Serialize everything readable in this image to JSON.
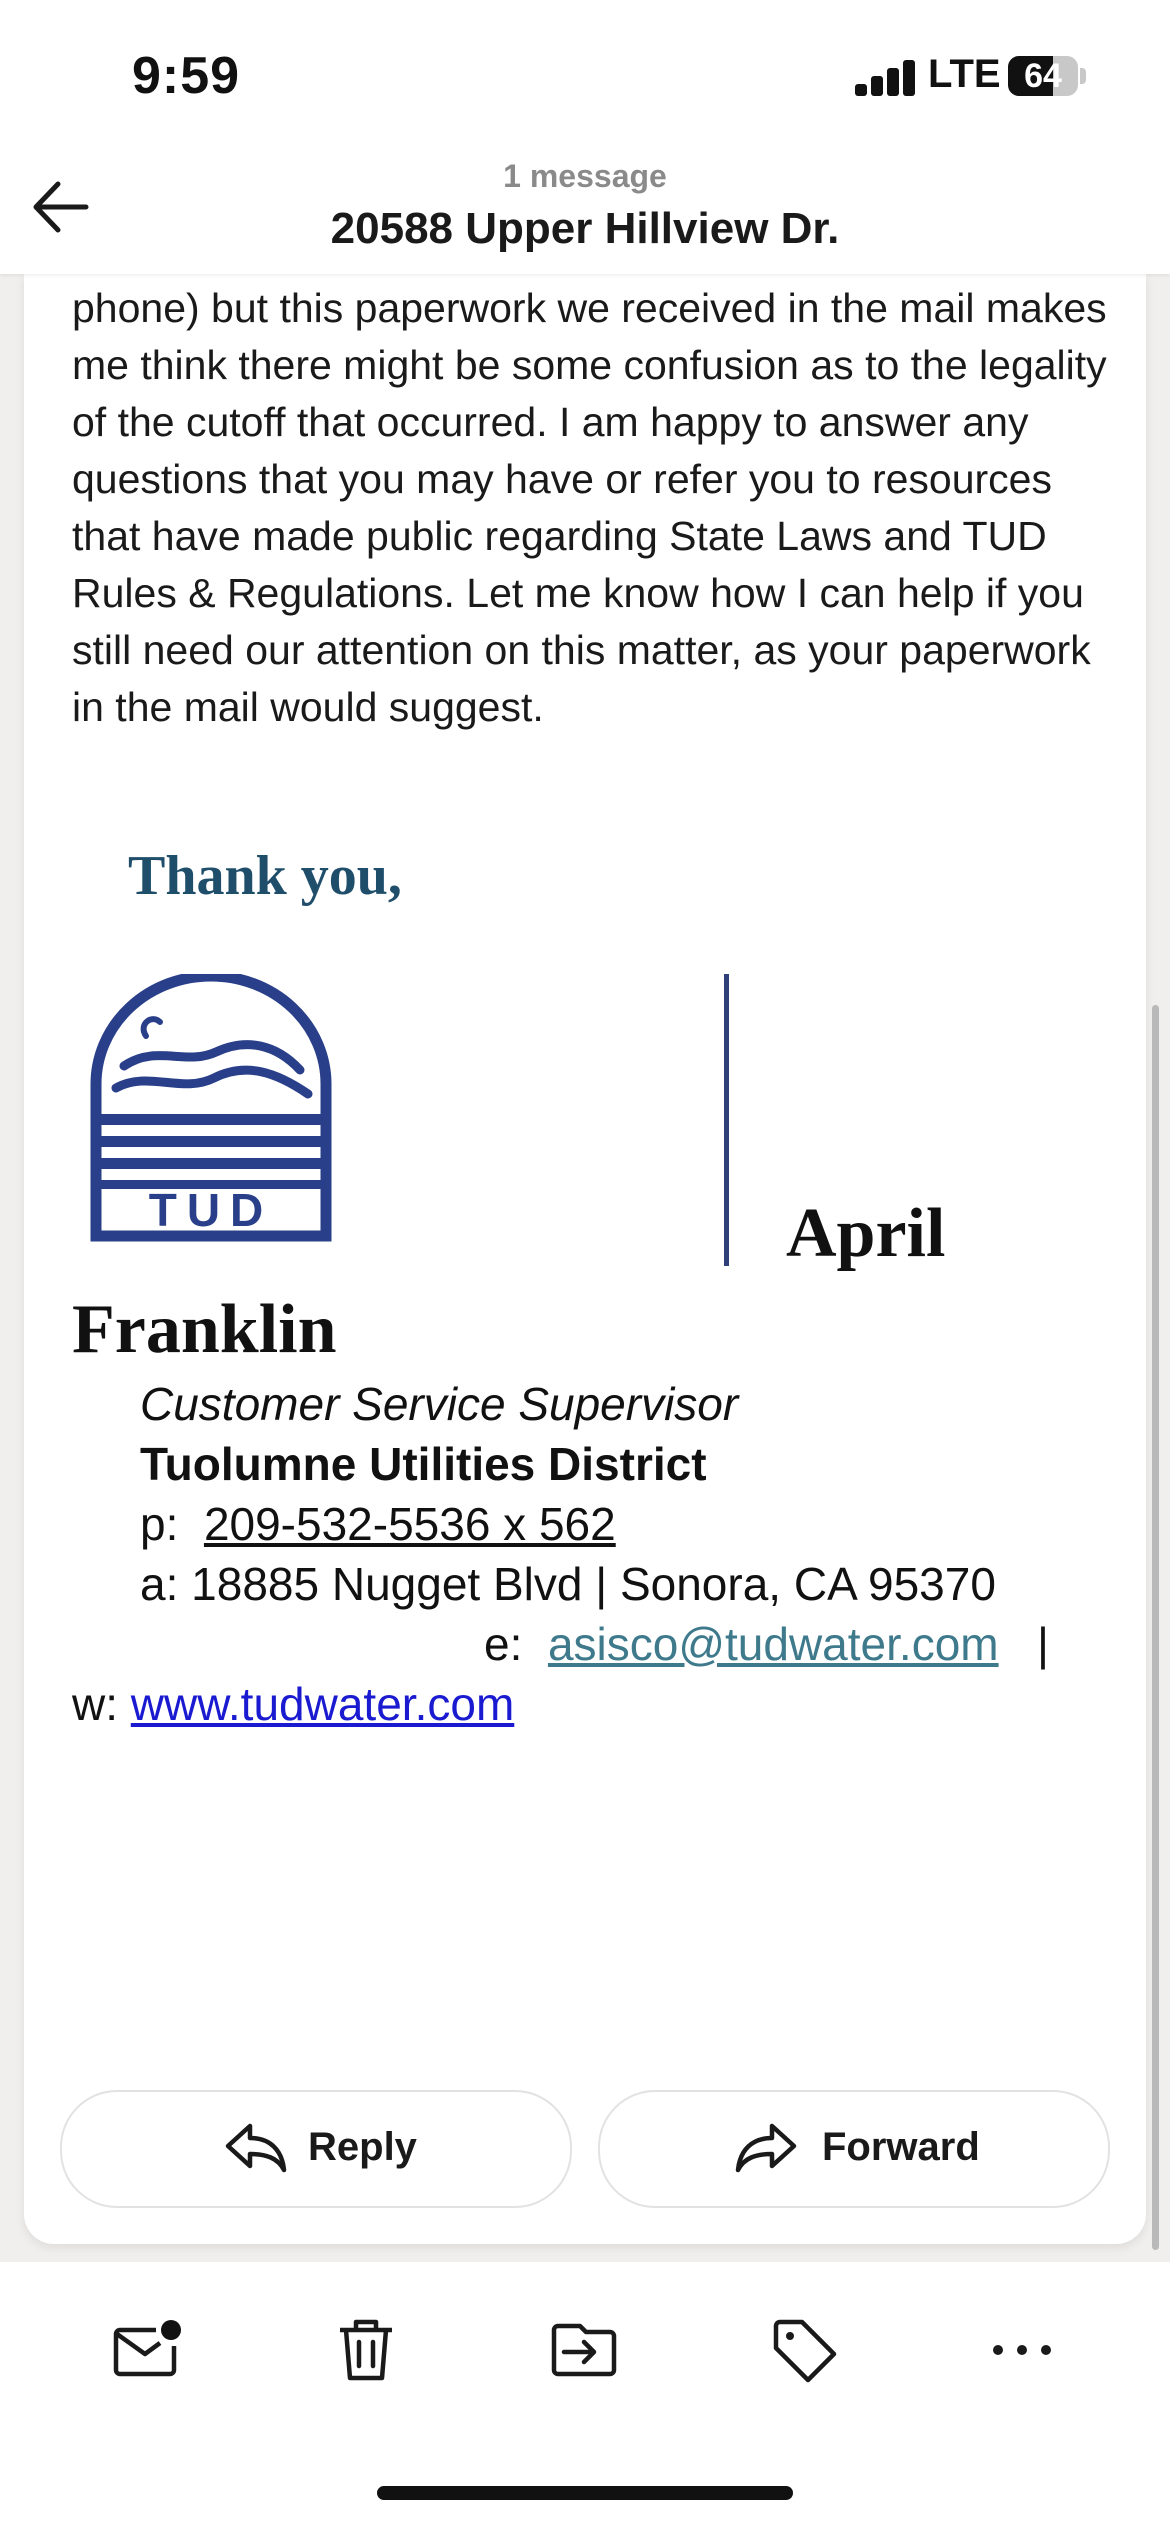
{
  "status_bar": {
    "time": "9:59",
    "network": "LTE",
    "battery_level": "64",
    "battery_fraction": 0.64
  },
  "header": {
    "subtitle": "1 message",
    "title": "20588 Upper Hillview Dr.",
    "back_icon": "back-arrow-icon"
  },
  "email": {
    "body_text": "phone) but this paperwork we received in the mail makes me think there might be some confusion as to the legality of the cutoff that occurred. I am happy to answer any questions that you may have or refer you to resources that have made public regarding State Laws and TUD Rules & Regulations. Let me know how I can help if you still need our attention on this matter, as your paperwork in the mail would suggest.",
    "closing": "Thank you,",
    "logo_text": "TUD",
    "signature": {
      "first_name": "April",
      "last_name": "Franklin",
      "title": "Customer Service Supervisor",
      "organization": "Tuolumne Utilities District",
      "phone_label": "p:",
      "phone": "209-532-5536 x 562",
      "address_label": "a:",
      "address": "18885 Nugget Blvd | Sonora, CA 95370",
      "email_label": "e:",
      "email": "asisco@tudwater.com",
      "separator": "|",
      "web_label": "w:",
      "web": "www.tudwater.com"
    }
  },
  "actions": {
    "reply_label": "Reply",
    "forward_label": "Forward"
  },
  "toolbar": {
    "icons": [
      "mail-unread-icon",
      "trash-icon",
      "move-to-folder-icon",
      "tag-icon",
      "more-icon"
    ]
  },
  "colors": {
    "closing_text": "#1f4e6b",
    "logo": "#2a3f8a",
    "email_link": "#3e7a8c",
    "web_link": "#1a1ad0",
    "divider_line": "#2f3f7a"
  }
}
